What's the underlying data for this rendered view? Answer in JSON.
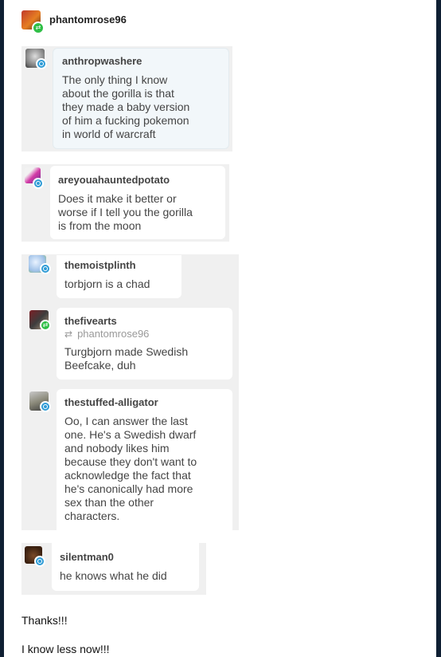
{
  "reblogger": {
    "username": "phantomrose96"
  },
  "thread": [
    {
      "username": "anthropwashere",
      "text": "The only thing I know\nabout the gorilla is that\nthey made a baby version\nof him a fucking pokemon\nin world of warcraft"
    },
    {
      "username": "areyouahauntedpotato",
      "text": "Does it make it better or\nworse if I tell you the gorilla\nis from the moon"
    },
    {
      "username": "themoistplinth",
      "text": "torbjorn is a chad"
    },
    {
      "username": "thefivearts",
      "via": "phantomrose96",
      "text": "Turgbjorn made Swedish\nBeefcake, duh"
    },
    {
      "username": "thestuffed-alligator",
      "text": "Oo, I can answer the last\none. He's a Swedish dwarf\nand nobody likes him\nbecause they don't want to\nacknowledge the fact that\nhe's canonically had more\nsex than the other\ncharacters."
    },
    {
      "username": "silentman0",
      "text": "he knows what he did"
    }
  ],
  "footer": {
    "line1": "Thanks!!!",
    "line2": "I know less now!!!"
  },
  "colors": {
    "badge_blue": "#2e9bd6",
    "badge_green": "#2fbf46",
    "frame": "#0f1f33"
  }
}
